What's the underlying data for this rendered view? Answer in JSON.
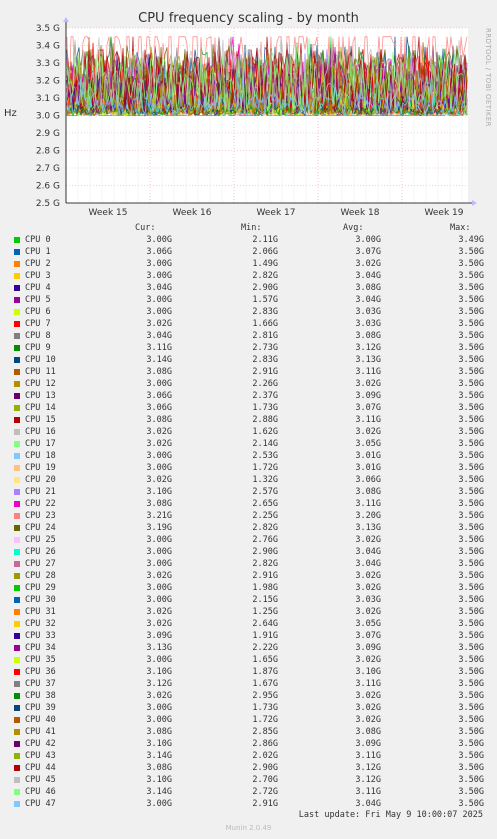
{
  "chart_data": {
    "type": "line",
    "title": "CPU frequency scaling - by month",
    "ylabel": "Hz",
    "side_label": "RRDTOOL / TOBI OETIKER",
    "ylim": [
      2.5,
      3.5
    ],
    "y_ticks": [
      "2.5 G",
      "2.6 G",
      "2.7 G",
      "2.8 G",
      "2.9 G",
      "3.0 G",
      "3.1 G",
      "3.2 G",
      "3.3 G",
      "3.4 G",
      "3.5 G"
    ],
    "x_ticks": [
      "Week 15",
      "Week 16",
      "Week 17",
      "Week 18",
      "Week 19"
    ],
    "columns": [
      "Cur:",
      "Min:",
      "Avg:",
      "Max:"
    ],
    "grid": true,
    "series": [
      {
        "name": "CPU 0",
        "color": "#00cc00",
        "cur": "3.00G",
        "min": "2.11G",
        "avg": "3.00G",
        "max": "3.49G"
      },
      {
        "name": "CPU 1",
        "color": "#0066b3",
        "cur": "3.06G",
        "min": "2.06G",
        "avg": "3.07G",
        "max": "3.50G"
      },
      {
        "name": "CPU 2",
        "color": "#ff8000",
        "cur": "3.00G",
        "min": "1.49G",
        "avg": "3.02G",
        "max": "3.50G"
      },
      {
        "name": "CPU 3",
        "color": "#ffcc00",
        "cur": "3.00G",
        "min": "2.82G",
        "avg": "3.04G",
        "max": "3.50G"
      },
      {
        "name": "CPU 4",
        "color": "#330099",
        "cur": "3.04G",
        "min": "2.90G",
        "avg": "3.08G",
        "max": "3.50G"
      },
      {
        "name": "CPU 5",
        "color": "#990099",
        "cur": "3.00G",
        "min": "1.57G",
        "avg": "3.04G",
        "max": "3.50G"
      },
      {
        "name": "CPU 6",
        "color": "#ccff00",
        "cur": "3.00G",
        "min": "2.83G",
        "avg": "3.03G",
        "max": "3.50G"
      },
      {
        "name": "CPU 7",
        "color": "#ff0000",
        "cur": "3.02G",
        "min": "1.66G",
        "avg": "3.03G",
        "max": "3.50G"
      },
      {
        "name": "CPU 8",
        "color": "#808080",
        "cur": "3.04G",
        "min": "2.81G",
        "avg": "3.08G",
        "max": "3.50G"
      },
      {
        "name": "CPU 9",
        "color": "#008f00",
        "cur": "3.11G",
        "min": "2.73G",
        "avg": "3.12G",
        "max": "3.50G"
      },
      {
        "name": "CPU 10",
        "color": "#00487d",
        "cur": "3.14G",
        "min": "2.83G",
        "avg": "3.13G",
        "max": "3.50G"
      },
      {
        "name": "CPU 11",
        "color": "#b35a00",
        "cur": "3.08G",
        "min": "2.91G",
        "avg": "3.11G",
        "max": "3.50G"
      },
      {
        "name": "CPU 12",
        "color": "#b38f00",
        "cur": "3.00G",
        "min": "2.26G",
        "avg": "3.02G",
        "max": "3.50G"
      },
      {
        "name": "CPU 13",
        "color": "#6b006b",
        "cur": "3.06G",
        "min": "2.37G",
        "avg": "3.09G",
        "max": "3.50G"
      },
      {
        "name": "CPU 14",
        "color": "#8fb300",
        "cur": "3.06G",
        "min": "1.73G",
        "avg": "3.07G",
        "max": "3.50G"
      },
      {
        "name": "CPU 15",
        "color": "#b30000",
        "cur": "3.08G",
        "min": "2.88G",
        "avg": "3.11G",
        "max": "3.50G"
      },
      {
        "name": "CPU 16",
        "color": "#bebebe",
        "cur": "3.02G",
        "min": "1.62G",
        "avg": "3.02G",
        "max": "3.50G"
      },
      {
        "name": "CPU 17",
        "color": "#80ff80",
        "cur": "3.02G",
        "min": "2.14G",
        "avg": "3.05G",
        "max": "3.50G"
      },
      {
        "name": "CPU 18",
        "color": "#80c9ff",
        "cur": "3.00G",
        "min": "2.53G",
        "avg": "3.01G",
        "max": "3.50G"
      },
      {
        "name": "CPU 19",
        "color": "#ffc080",
        "cur": "3.00G",
        "min": "1.72G",
        "avg": "3.01G",
        "max": "3.50G"
      },
      {
        "name": "CPU 20",
        "color": "#ffe680",
        "cur": "3.02G",
        "min": "1.32G",
        "avg": "3.06G",
        "max": "3.50G"
      },
      {
        "name": "CPU 21",
        "color": "#aa80ff",
        "cur": "3.10G",
        "min": "2.57G",
        "avg": "3.08G",
        "max": "3.50G"
      },
      {
        "name": "CPU 22",
        "color": "#ee00cc",
        "cur": "3.08G",
        "min": "2.65G",
        "avg": "3.11G",
        "max": "3.50G"
      },
      {
        "name": "CPU 23",
        "color": "#ff8080",
        "cur": "3.21G",
        "min": "2.25G",
        "avg": "3.20G",
        "max": "3.50G"
      },
      {
        "name": "CPU 24",
        "color": "#666600",
        "cur": "3.19G",
        "min": "2.82G",
        "avg": "3.13G",
        "max": "3.50G"
      },
      {
        "name": "CPU 25",
        "color": "#ffbfff",
        "cur": "3.00G",
        "min": "2.76G",
        "avg": "3.02G",
        "max": "3.50G"
      },
      {
        "name": "CPU 26",
        "color": "#00ffcc",
        "cur": "3.00G",
        "min": "2.90G",
        "avg": "3.04G",
        "max": "3.50G"
      },
      {
        "name": "CPU 27",
        "color": "#cc6699",
        "cur": "3.00G",
        "min": "2.82G",
        "avg": "3.04G",
        "max": "3.50G"
      },
      {
        "name": "CPU 28",
        "color": "#999900",
        "cur": "3.02G",
        "min": "2.91G",
        "avg": "3.02G",
        "max": "3.50G"
      },
      {
        "name": "CPU 29",
        "color": "#00cc00",
        "cur": "3.00G",
        "min": "1.98G",
        "avg": "3.02G",
        "max": "3.50G"
      },
      {
        "name": "CPU 30",
        "color": "#0066b3",
        "cur": "3.00G",
        "min": "2.15G",
        "avg": "3.03G",
        "max": "3.50G"
      },
      {
        "name": "CPU 31",
        "color": "#ff8000",
        "cur": "3.02G",
        "min": "1.25G",
        "avg": "3.02G",
        "max": "3.50G"
      },
      {
        "name": "CPU 32",
        "color": "#ffcc00",
        "cur": "3.02G",
        "min": "2.64G",
        "avg": "3.05G",
        "max": "3.50G"
      },
      {
        "name": "CPU 33",
        "color": "#330099",
        "cur": "3.09G",
        "min": "1.91G",
        "avg": "3.07G",
        "max": "3.50G"
      },
      {
        "name": "CPU 34",
        "color": "#990099",
        "cur": "3.13G",
        "min": "2.22G",
        "avg": "3.09G",
        "max": "3.50G"
      },
      {
        "name": "CPU 35",
        "color": "#ccff00",
        "cur": "3.00G",
        "min": "1.65G",
        "avg": "3.02G",
        "max": "3.50G"
      },
      {
        "name": "CPU 36",
        "color": "#ff0000",
        "cur": "3.10G",
        "min": "1.87G",
        "avg": "3.10G",
        "max": "3.50G"
      },
      {
        "name": "CPU 37",
        "color": "#808080",
        "cur": "3.12G",
        "min": "1.67G",
        "avg": "3.11G",
        "max": "3.50G"
      },
      {
        "name": "CPU 38",
        "color": "#008f00",
        "cur": "3.02G",
        "min": "2.95G",
        "avg": "3.02G",
        "max": "3.50G"
      },
      {
        "name": "CPU 39",
        "color": "#00487d",
        "cur": "3.00G",
        "min": "1.73G",
        "avg": "3.02G",
        "max": "3.50G"
      },
      {
        "name": "CPU 40",
        "color": "#b35a00",
        "cur": "3.00G",
        "min": "1.72G",
        "avg": "3.02G",
        "max": "3.50G"
      },
      {
        "name": "CPU 41",
        "color": "#b38f00",
        "cur": "3.08G",
        "min": "2.85G",
        "avg": "3.08G",
        "max": "3.50G"
      },
      {
        "name": "CPU 42",
        "color": "#6b006b",
        "cur": "3.10G",
        "min": "2.86G",
        "avg": "3.09G",
        "max": "3.50G"
      },
      {
        "name": "CPU 43",
        "color": "#8fb300",
        "cur": "3.14G",
        "min": "2.02G",
        "avg": "3.11G",
        "max": "3.50G"
      },
      {
        "name": "CPU 44",
        "color": "#b30000",
        "cur": "3.08G",
        "min": "2.90G",
        "avg": "3.12G",
        "max": "3.50G"
      },
      {
        "name": "CPU 45",
        "color": "#bebebe",
        "cur": "3.10G",
        "min": "2.70G",
        "avg": "3.12G",
        "max": "3.50G"
      },
      {
        "name": "CPU 46",
        "color": "#80ff80",
        "cur": "3.14G",
        "min": "2.72G",
        "avg": "3.11G",
        "max": "3.50G"
      },
      {
        "name": "CPU 47",
        "color": "#80c9ff",
        "cur": "3.00G",
        "min": "2.91G",
        "avg": "3.04G",
        "max": "3.50G"
      }
    ]
  },
  "footer": {
    "last_update": "Last update: Fri May  9 10:00:07 2025",
    "munin_version": "Munin 2.0.49"
  }
}
